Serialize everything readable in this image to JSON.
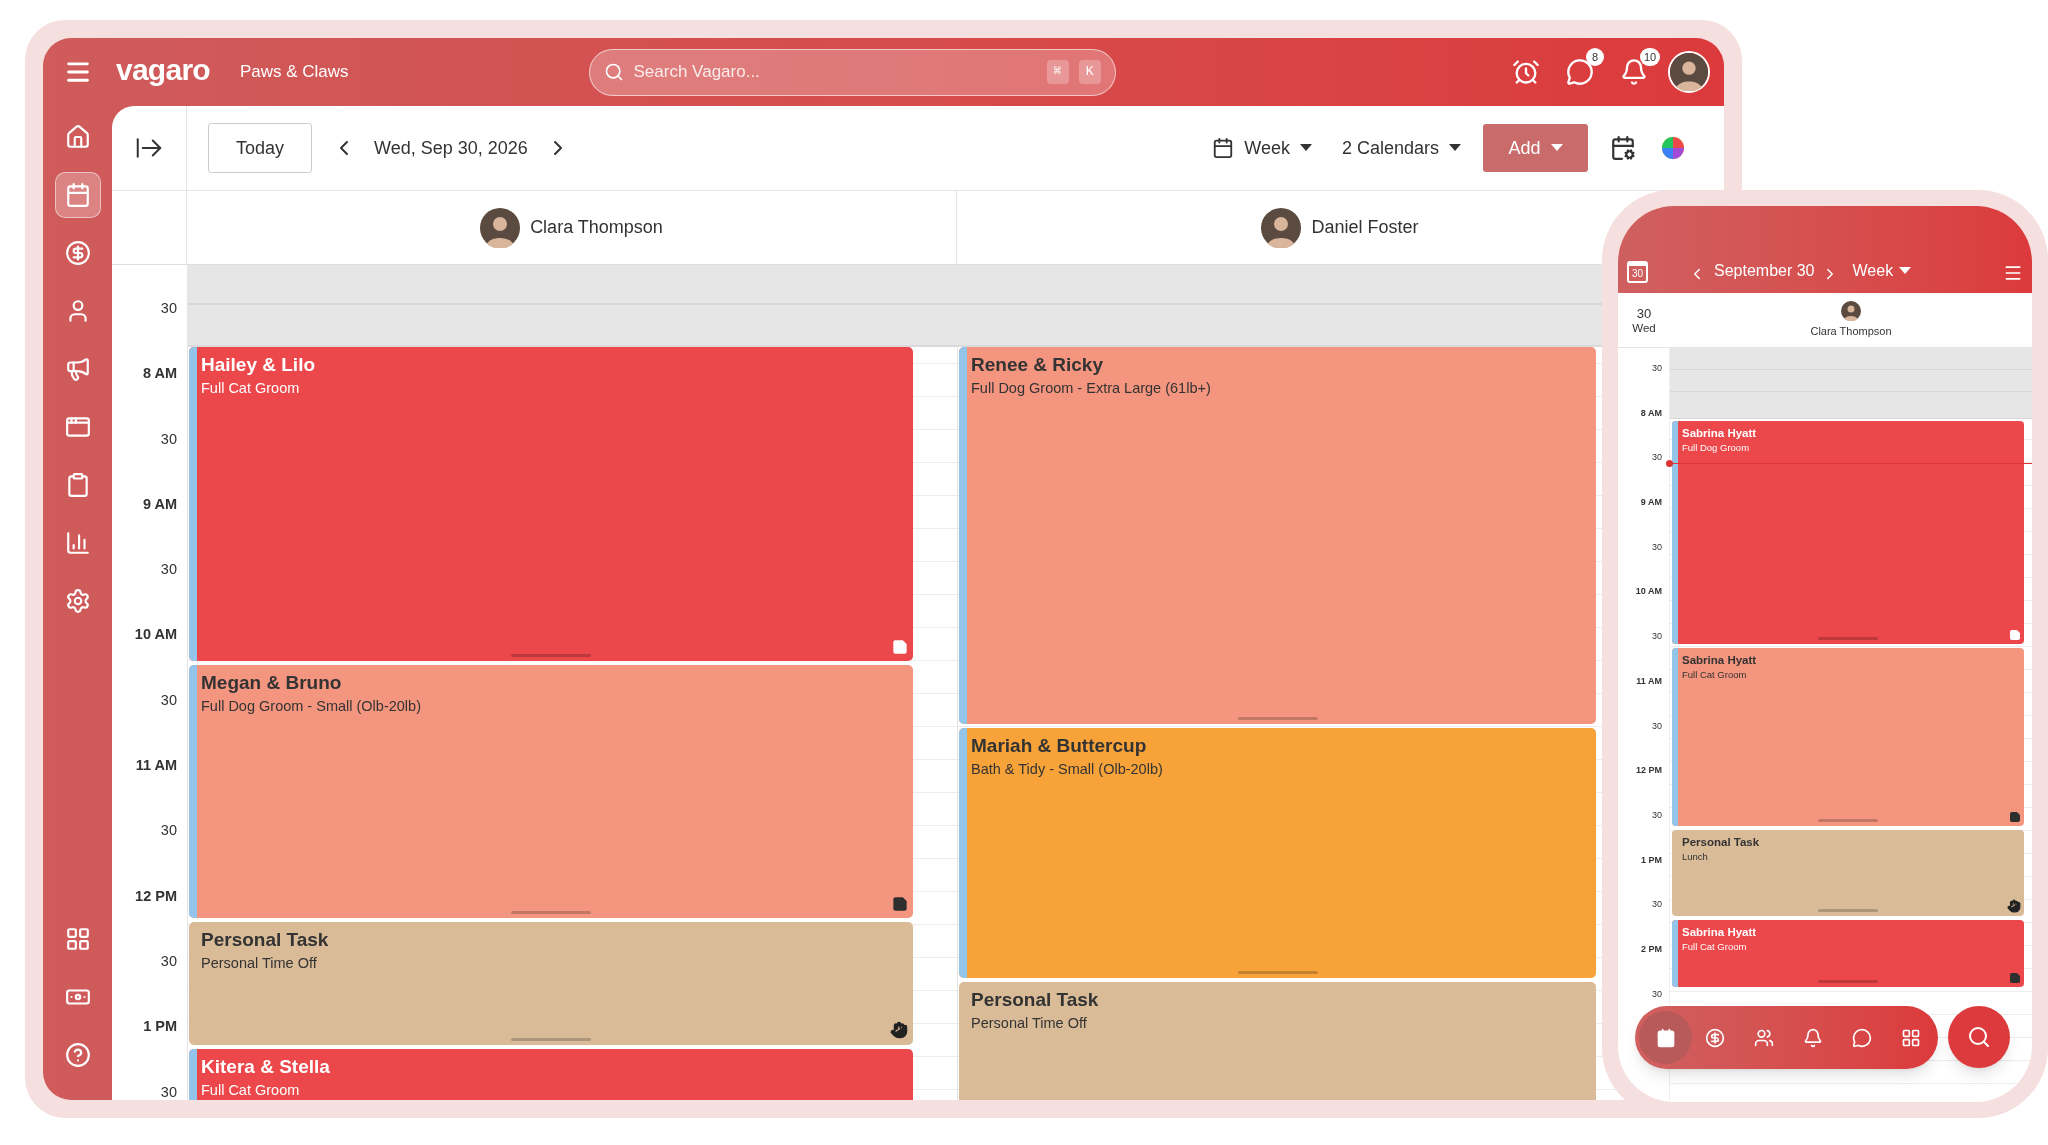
{
  "top_bar": {
    "logo": "vagaro",
    "business": "Paws & Claws",
    "search": {
      "placeholder": "Search Vagaro...",
      "keys": [
        "⌘",
        "K"
      ]
    },
    "message_badge": "8",
    "notification_badge": "10"
  },
  "sidebar": {
    "items": [
      {
        "kind": "home",
        "selected": false
      },
      {
        "kind": "calendar",
        "selected": true
      },
      {
        "kind": "dollar",
        "selected": false
      },
      {
        "kind": "user",
        "selected": false
      },
      {
        "kind": "megaphone",
        "selected": false
      },
      {
        "kind": "window",
        "selected": false
      },
      {
        "kind": "clipboard",
        "selected": false
      },
      {
        "kind": "chart",
        "selected": false
      },
      {
        "kind": "settings",
        "selected": false
      }
    ],
    "bottom_items": [
      {
        "kind": "apps",
        "selected": false
      },
      {
        "kind": "money",
        "selected": false
      },
      {
        "kind": "help",
        "selected": false
      }
    ]
  },
  "toolbar": {
    "today": "Today",
    "date": "Wed, Sep 30, 2026",
    "view": "Week",
    "calendars": "2 Calendars",
    "add": "Add"
  },
  "time_labels": [
    "30",
    "8 AM",
    "30",
    "9 AM",
    "30",
    "10 AM",
    "30",
    "11 AM",
    "30",
    "12 PM",
    "30",
    "1 PM",
    "30"
  ],
  "columns": [
    {
      "staff": "Clara Thompson",
      "events": [
        {
          "kind": "appointment",
          "title": "Hailey & Lilo",
          "service": "Full Cat Groom",
          "color": "#ec474a",
          "marker": {
            "kind": "note-light"
          }
        },
        {
          "kind": "appointment",
          "title": "Megan & Bruno",
          "service": "Full Dog Groom - Small (Olb-20lb)",
          "color": "#f4957f",
          "marker": {
            "kind": "note-dark"
          }
        },
        {
          "kind": "task",
          "title": "Personal Task",
          "service": "Personal Time Off",
          "color": "#d9bb98",
          "marker": {
            "kind": "hand"
          }
        },
        {
          "kind": "appointment",
          "title": "Kitera & Stella",
          "service": "Full Cat Groom",
          "color": "#ec474a"
        }
      ]
    },
    {
      "staff": "Daniel Foster",
      "events": [
        {
          "kind": "appointment",
          "title": "Renee & Ricky",
          "service": "Full Dog Groom - Extra Large (61lb+)",
          "color": "#f4957f"
        },
        {
          "kind": "appointment",
          "title": "Mariah & Buttercup",
          "service": "Bath & Tidy - Small (Olb-20lb)",
          "color": "#f7a33a"
        },
        {
          "kind": "task",
          "title": "Personal Task",
          "service": "Personal Time Off",
          "color": "#d9bb98"
        }
      ]
    }
  ],
  "phone": {
    "calendar_icon_day": "30",
    "date": "September 30",
    "view": "Week",
    "day_number": "30",
    "weekday": "Wed",
    "staff": "Clara Thompson",
    "time_labels": [
      "30",
      "8 AM",
      "30",
      "9 AM",
      "30",
      "10 AM",
      "30",
      "11 AM",
      "30",
      "12 PM",
      "30",
      "1 PM",
      "30",
      "2 PM",
      "30"
    ],
    "events": [
      {
        "kind": "appointment",
        "title": "Sabrina Hyatt",
        "service": "Full Dog Groom",
        "color": "#ec474a",
        "marker": {
          "kind": "note-light"
        }
      },
      {
        "kind": "appointment",
        "title": "Sabrina Hyatt",
        "service": "Full Cat Groom",
        "color": "#f4957f",
        "marker": {
          "kind": "note-dark"
        }
      },
      {
        "kind": "task",
        "title": "Personal Task",
        "service": "Lunch",
        "color": "#d9bb98",
        "marker": {
          "kind": "hand"
        }
      },
      {
        "kind": "appointment",
        "title": "Sabrina Hyatt",
        "service": "Full Cat Groom",
        "color": "#ec474a",
        "marker": {
          "kind": "note-dark"
        }
      }
    ],
    "nav_items": [
      {
        "kind": "calendar",
        "selected": true
      },
      {
        "kind": "dollar",
        "selected": false
      },
      {
        "kind": "people",
        "selected": false
      },
      {
        "kind": "bell",
        "selected": false
      },
      {
        "kind": "chat",
        "selected": false
      },
      {
        "kind": "apps",
        "selected": false
      }
    ]
  }
}
